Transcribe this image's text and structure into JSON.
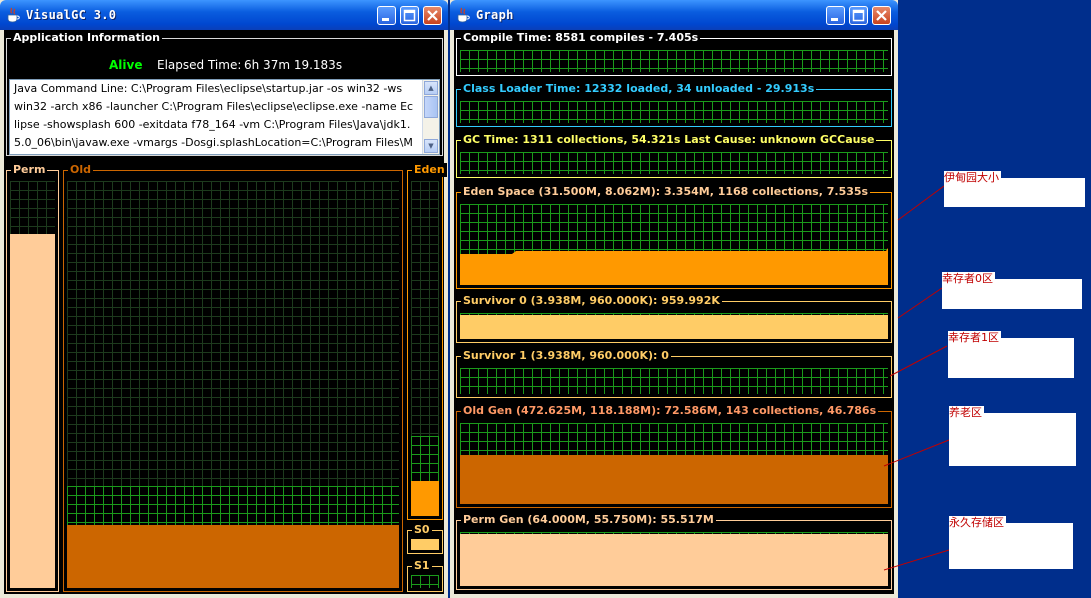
{
  "left_window": {
    "title": "VisualGC 3.0",
    "app_info": {
      "label": "Application Information",
      "status": "Alive",
      "elapsed_label": "Elapsed Time:",
      "elapsed_value": "6h 37m 19.183s",
      "command_lines": [
        "Java Command Line: C:\\Program Files\\eclipse\\startup.jar -os win32 -ws",
        "win32 -arch x86 -launcher C:\\Program Files\\eclipse\\eclipse.exe -name Ec",
        "lipse -showsplash 600 -exitdata f78_164 -vm C:\\Program Files\\Java\\jdk1.",
        "5.0_06\\bin\\javaw.exe -vmargs -Dosgi.splashLocation=C:\\Program Files\\M"
      ]
    },
    "spaces": {
      "perm": {
        "label": "Perm",
        "fill": 0.87
      },
      "old": {
        "label": "Old",
        "fill": 0.154
      },
      "eden": {
        "label": "Eden",
        "fill": 0.106
      },
      "s0": {
        "label": "S0",
        "fill": 1.0
      },
      "s1": {
        "label": "S1",
        "fill": 0.0
      }
    }
  },
  "right_window": {
    "title": "Graph",
    "graphs": [
      {
        "label": "Compile Time: 8581 compiles - 7.405s"
      },
      {
        "label": "Class Loader Time: 12332 loaded, 34 unloaded - 29.913s"
      },
      {
        "label": "GC Time: 1311 collections, 54.321s  Last Cause: unknown GCCause"
      },
      {
        "label": "Eden Space (31.500M, 8.062M): 3.354M, 1168 collections, 7.535s"
      },
      {
        "label": "Survivor 0 (3.938M, 960.000K): 959.992K"
      },
      {
        "label": "Survivor 1 (3.938M, 960.000K): 0"
      },
      {
        "label": "Old Gen (472.625M, 118.188M): 72.586M, 143 collections, 46.786s"
      },
      {
        "label": "Perm Gen (64.000M, 55.750M): 55.517M"
      }
    ]
  },
  "annotations": [
    {
      "text": "伊甸园大小"
    },
    {
      "text": "幸存者0区"
    },
    {
      "text": "幸存者1区"
    },
    {
      "text": "养老区"
    },
    {
      "text": "永久存储区"
    }
  ],
  "colors": {
    "desktop": "#002e8c",
    "grid_line": "#1b9a1b",
    "eden_fill": "#ff9900",
    "survivor_fill": "#ffcc66",
    "old_fill": "#cc6600",
    "perm_fill": "#ffcc99",
    "alive": "#00ff00",
    "annotation_text": "#c00000"
  }
}
